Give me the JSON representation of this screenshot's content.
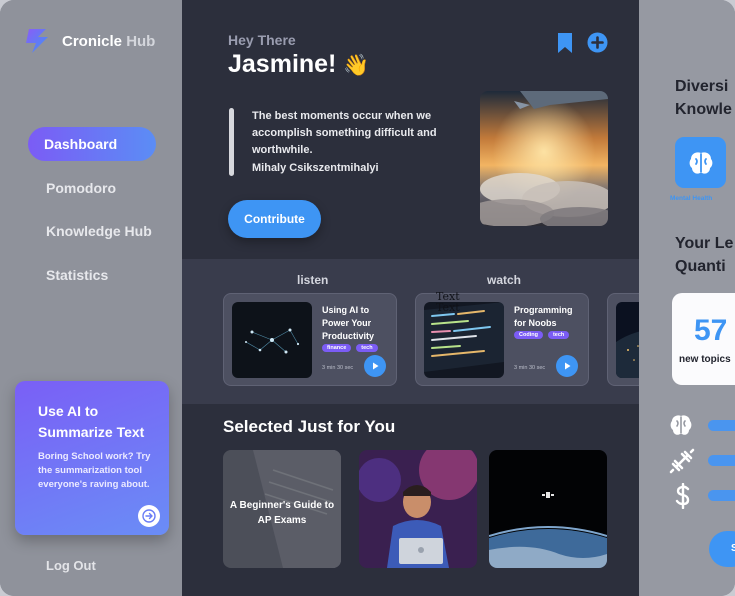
{
  "app": {
    "name": "Cronicle",
    "name_suffix": "Hub"
  },
  "sidebar": {
    "items": [
      {
        "label": "Dashboard",
        "active": true
      },
      {
        "label": "Pomodoro"
      },
      {
        "label": "Knowledge Hub"
      },
      {
        "label": "Statistics"
      }
    ],
    "promo": {
      "title": "Use AI to Summarize Text",
      "body": "Boring School work? Try the summarization tool everyone's raving about."
    },
    "logout_label": "Log Out"
  },
  "header": {
    "greeting": "Hey There",
    "name": "Jasmine!",
    "wave": "👋",
    "icons": [
      "bookmark-icon",
      "add-circle-icon"
    ]
  },
  "quote": {
    "text": "The best moments occur when  we accomplish something difficult and worthwhile.",
    "author": "Mihaly Csikszentmihalyi"
  },
  "contribute_label": "Contribute",
  "media": {
    "tabs": [
      "listen",
      "watch"
    ],
    "cards": [
      {
        "title": "Using AI to Power Your Productivity",
        "tags": [
          "finance",
          "tech"
        ],
        "duration": "3 min 30 sec"
      },
      {
        "title": "Programming for Noobs",
        "tags": [
          "Coding",
          "tech"
        ],
        "duration": "3 min 30 sec"
      }
    ],
    "stray_text": [
      "Text",
      "Text"
    ]
  },
  "picks": {
    "title": "Selected Just for You",
    "items": [
      {
        "label": "A Beginner's Guide to AP Exams"
      },
      {
        "label": ""
      },
      {
        "label": ""
      }
    ]
  },
  "right_panel": {
    "title_lines": [
      "Diversi",
      "Knowle"
    ],
    "brain_caption": "Mental Health",
    "section_lines": [
      "Your Le",
      "Quanti"
    ],
    "stat": {
      "value": "57",
      "label": "new topics"
    },
    "rows": [
      {
        "icon": "brain-icon"
      },
      {
        "icon": "dumbbell-icon"
      },
      {
        "icon": "dollar-icon"
      }
    ],
    "button_label": "S"
  },
  "colors": {
    "accent_blue": "#3e95f4",
    "accent_purple": "#7b5cf5",
    "main_bg": "#2c2f3c"
  }
}
